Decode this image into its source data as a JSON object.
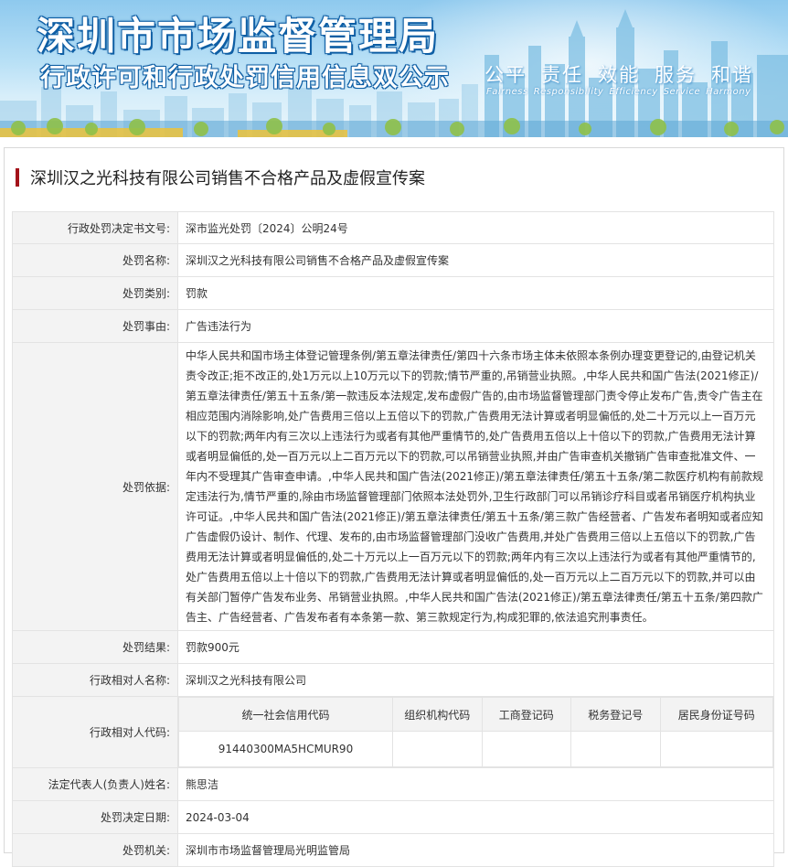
{
  "banner": {
    "title": "深圳市市场监督管理局",
    "subtitle": "行政许可和行政处罚信用信息双公示",
    "slogan": [
      "公平",
      "责任",
      "效能",
      "服务",
      "和谐"
    ],
    "slogan_en": [
      "Fairness",
      "Responsibility",
      "Efficiency",
      "Service",
      "Harmony"
    ]
  },
  "case_title": "深圳汉之光科技有限公司销售不合格产品及虚假宣传案",
  "fields": {
    "doc_no": {
      "label": "行政处罚决定书文号:",
      "value": "深市监光处罚〔2024〕公明24号"
    },
    "penalty_name": {
      "label": "处罚名称:",
      "value": "深圳汉之光科技有限公司销售不合格产品及虚假宣传案"
    },
    "penalty_type": {
      "label": "处罚类别:",
      "value": "罚款"
    },
    "penalty_reason": {
      "label": "处罚事由:",
      "value": "广告违法行为"
    },
    "penalty_basis": {
      "label": "处罚依据:",
      "value": "中华人民共和国市场主体登记管理条例/第五章法律责任/第四十六条市场主体未依照本条例办理变更登记的,由登记机关责令改正;拒不改正的,处1万元以上10万元以下的罚款;情节严重的,吊销营业执照。,中华人民共和国广告法(2021修正)/第五章法律责任/第五十五条/第一款违反本法规定,发布虚假广告的,由市场监督管理部门责令停止发布广告,责令广告主在相应范围内消除影响,处广告费用三倍以上五倍以下的罚款,广告费用无法计算或者明显偏低的,处二十万元以上一百万元以下的罚款;两年内有三次以上违法行为或者有其他严重情节的,处广告费用五倍以上十倍以下的罚款,广告费用无法计算或者明显偏低的,处一百万元以上二百万元以下的罚款,可以吊销营业执照,并由广告审查机关撤销广告审查批准文件、一年内不受理其广告审查申请。,中华人民共和国广告法(2021修正)/第五章法律责任/第五十五条/第二款医疗机构有前款规定违法行为,情节严重的,除由市场监督管理部门依照本法处罚外,卫生行政部门可以吊销诊疗科目或者吊销医疗机构执业许可证。,中华人民共和国广告法(2021修正)/第五章法律责任/第五十五条/第三款广告经营者、广告发布者明知或者应知广告虚假仍设计、制作、代理、发布的,由市场监督管理部门没收广告费用,并处广告费用三倍以上五倍以下的罚款,广告费用无法计算或者明显偏低的,处二十万元以上一百万元以下的罚款;两年内有三次以上违法行为或者有其他严重情节的,处广告费用五倍以上十倍以下的罚款,广告费用无法计算或者明显偏低的,处一百万元以上二百万元以下的罚款,并可以由有关部门暂停广告发布业务、吊销营业执照。,中华人民共和国广告法(2021修正)/第五章法律责任/第五十五条/第四款广告主、广告经营者、广告发布者有本条第一款、第三款规定行为,构成犯罪的,依法追究刑事责任。"
    },
    "penalty_result": {
      "label": "处罚结果:",
      "value": "罚款900元"
    },
    "party_name": {
      "label": "行政相对人名称:",
      "value": "深圳汉之光科技有限公司"
    },
    "party_code": {
      "label": "行政相对人代码:",
      "headers": [
        "统一社会信用代码",
        "组织机构代码",
        "工商登记码",
        "税务登记号",
        "居民身份证号码"
      ],
      "values": [
        "91440300MA5HCMUR90",
        "",
        "",
        "",
        ""
      ]
    },
    "legal_rep": {
      "label": "法定代表人(负责人)姓名:",
      "value": "熊思洁"
    },
    "decision_date": {
      "label": "处罚决定日期:",
      "value": "2024-03-04"
    },
    "authority": {
      "label": "处罚机关:",
      "value": "深圳市市场监督管理局光明监管局"
    }
  }
}
